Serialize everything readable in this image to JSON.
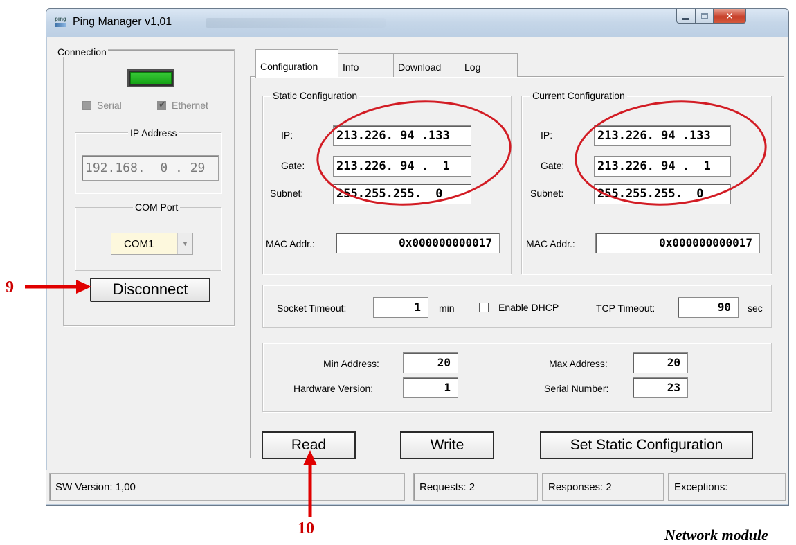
{
  "window": {
    "title": "Ping Manager v1,01",
    "icon_text": "ping",
    "controls": {
      "minimize": "minimize-icon",
      "maximize": "maximize-icon",
      "close": "close-icon"
    }
  },
  "connection": {
    "legend": "Connection",
    "status_color": "#22b022",
    "serial_label": "Serial",
    "ethernet_label": "Ethernet",
    "ip_legend": "IP Address",
    "ip_value": "192.168.  0 . 29",
    "com_legend": "COM Port",
    "com_value": "COM1",
    "disconnect_label": "Disconnect"
  },
  "tabs": [
    {
      "label": "Configuration",
      "active": true
    },
    {
      "label": "Info"
    },
    {
      "label": "Download"
    },
    {
      "label": "Log"
    }
  ],
  "static_config": {
    "legend": "Static Configuration",
    "ip_label": "IP:",
    "ip": "213.226. 94 .133",
    "gate_label": "Gate:",
    "gate": "213.226. 94 .  1",
    "subnet_label": "Subnet:",
    "subnet": "255.255.255.  0",
    "mac_label": "MAC Addr.:",
    "mac": "0x000000000017"
  },
  "current_config": {
    "legend": "Current Configuration",
    "ip_label": "IP:",
    "ip": "213.226. 94 .133",
    "gate_label": "Gate:",
    "gate": "213.226. 94 .  1",
    "subnet_label": "Subnet:",
    "subnet": "255.255.255.  0",
    "mac_label": "MAC Addr.:",
    "mac": "0x000000000017"
  },
  "timeouts": {
    "socket_label": "Socket Timeout:",
    "socket_value": "1",
    "socket_unit": "min",
    "dhcp_label": "Enable DHCP",
    "dhcp_checked": false,
    "tcp_label": "TCP Timeout:",
    "tcp_value": "90",
    "tcp_unit": "sec"
  },
  "device": {
    "min_address_label": "Min Address:",
    "min_address": "20",
    "max_address_label": "Max Address:",
    "max_address": "20",
    "hw_version_label": "Hardware Version:",
    "hw_version": "1",
    "serial_number_label": "Serial Number:",
    "serial_number": "23"
  },
  "buttons": {
    "read": "Read",
    "write": "Write",
    "set_static": "Set Static Configuration"
  },
  "status_bar": {
    "sw_version": "SW Version: 1,00",
    "requests": "Requests: 2",
    "responses": "Responses: 2",
    "exceptions": "Exceptions:"
  },
  "annotations": {
    "label_9": "9",
    "label_10": "10",
    "caption": "Network module",
    "highlight_color": "#d21c24",
    "arrow_color": "#e00000"
  }
}
